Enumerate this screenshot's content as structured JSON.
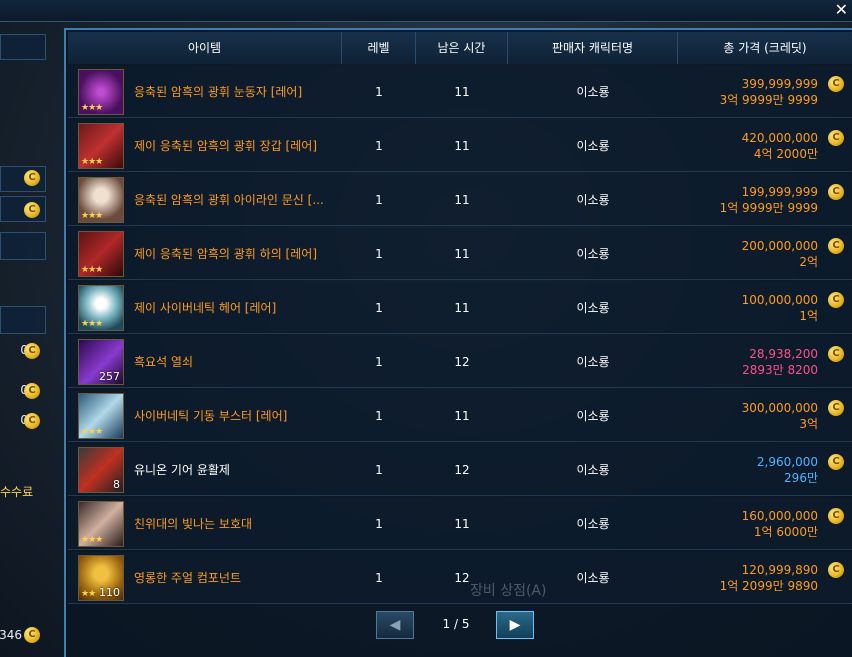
{
  "window": {
    "close_glyph": "✕"
  },
  "left_panel": {
    "values": [
      "0",
      "0",
      "0",
      "0",
      "0"
    ],
    "fee_label": "수수료",
    "bottom_value": "346",
    "coin_glyph": "C"
  },
  "table": {
    "headers": {
      "item": "아이템",
      "level": "레벨",
      "time_left": "남은 시간",
      "seller": "판매자 캐릭터명",
      "price": "총 가격 (크레딧)"
    },
    "rows": [
      {
        "name": "응축된 암흑의 광휘 눈동자 [레어]",
        "name_color": "orange",
        "icon": "dark-eye-icon",
        "stars": "★★★",
        "qty": "",
        "level": "1",
        "time": "11",
        "seller": "이소룡",
        "price": "399,999,999",
        "price_kr": "3억 9999만 9999",
        "price_color": "orange"
      },
      {
        "name": "제이 응축된 암흑의 광휘 장갑 [레어]",
        "name_color": "orange",
        "icon": "dark-gloves-icon",
        "stars": "★★★",
        "qty": "",
        "level": "1",
        "time": "11",
        "seller": "이소룡",
        "price": "420,000,000",
        "price_kr": "4억 2000만",
        "price_color": "orange"
      },
      {
        "name": "응축된 암흑의 광휘 아이라인 문신 [...",
        "name_color": "orange",
        "icon": "eyeline-tattoo-icon",
        "stars": "★★★",
        "qty": "",
        "level": "1",
        "time": "11",
        "seller": "이소룡",
        "price": "199,999,999",
        "price_kr": "1억 9999만 9999",
        "price_color": "orange"
      },
      {
        "name": "제이 응축된 암흑의 광휘 하의 [레어]",
        "name_color": "orange",
        "icon": "dark-pants-icon",
        "stars": "★★★",
        "qty": "",
        "level": "1",
        "time": "11",
        "seller": "이소룡",
        "price": "200,000,000",
        "price_kr": "2억",
        "price_color": "orange"
      },
      {
        "name": "제이 사이버네틱 헤어 [레어]",
        "name_color": "orange",
        "icon": "cyber-hair-icon",
        "stars": "★★★",
        "qty": "",
        "level": "1",
        "time": "11",
        "seller": "이소룡",
        "price": "100,000,000",
        "price_kr": "1억",
        "price_color": "orange"
      },
      {
        "name": "흑요석 열쇠",
        "name_color": "orange",
        "icon": "obsidian-key-icon",
        "stars": "",
        "qty": "257",
        "level": "1",
        "time": "12",
        "seller": "이소룡",
        "price": "28,938,200",
        "price_kr": "2893만 8200",
        "price_color": "pink"
      },
      {
        "name": "사이버네틱 기동 부스터 [레어]",
        "name_color": "orange",
        "icon": "cyber-booster-icon",
        "stars": "★★★",
        "qty": "",
        "level": "1",
        "time": "11",
        "seller": "이소룡",
        "price": "300,000,000",
        "price_kr": "3억",
        "price_color": "orange"
      },
      {
        "name": "유니온 기어 윤활제",
        "name_color": "white",
        "icon": "gear-lubricant-icon",
        "stars": "",
        "qty": "8",
        "level": "1",
        "time": "12",
        "seller": "이소룡",
        "price": "2,960,000",
        "price_kr": "296만",
        "price_color": "blue"
      },
      {
        "name": "친위대의 빛나는 보호대",
        "name_color": "orange",
        "icon": "guard-bracer-icon",
        "stars": "★★★",
        "qty": "",
        "level": "1",
        "time": "11",
        "seller": "이소룡",
        "price": "160,000,000",
        "price_kr": "1억 6000만",
        "price_color": "orange"
      },
      {
        "name": "영롱한 주얼 컴포넌트",
        "name_color": "orange",
        "icon": "jewel-component-icon",
        "stars": "★★",
        "qty": "110",
        "level": "1",
        "time": "12",
        "seller": "이소룡",
        "price": "120,999,890",
        "price_kr": "1억 2099만 9890",
        "price_color": "orange"
      }
    ]
  },
  "pagination": {
    "prev_glyph": "◀",
    "next_glyph": "▶",
    "page_label": "1 / 5"
  },
  "background_text": {
    "shop_label": "장비 상점(A)"
  }
}
